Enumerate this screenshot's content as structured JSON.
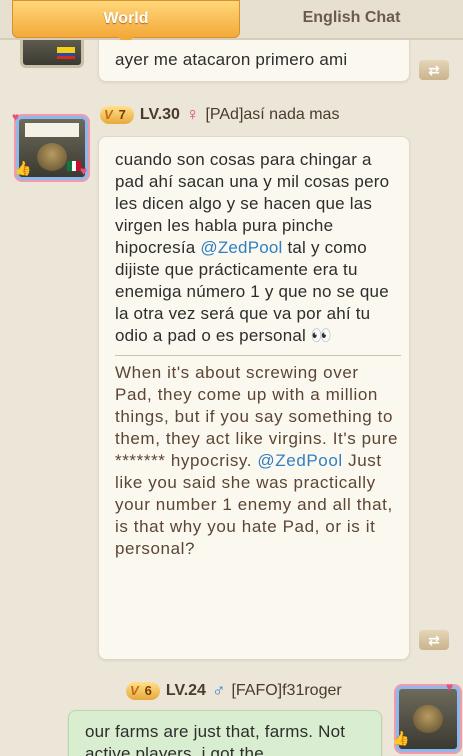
{
  "tabs": {
    "world": "World",
    "english": "English Chat"
  },
  "messages": [
    {
      "text": "ayer me atacaron primero ami"
    },
    {
      "vip": "7",
      "level": "LV.30",
      "gender": "female",
      "name": "[PAd]así nada mas",
      "original_parts": [
        "cuando son cosas para chingar a pad ahí sacan una y mil cosas pero les dicen algo y se hacen que las virgen les habla pura pinche hipocresía ",
        "@ZedPool",
        " tal y como dijiste que prácticamente era tu enemiga número 1 y que no se que la otra vez será que va por ahí tu odio a pad o es personal 👀"
      ],
      "translation_parts": [
        "When it's about screwing over Pad, they come up with a million things, but if you say something to them, they act like virgins. It's pure ******* hypocrisy. ",
        "@ZedPool",
        " Just like you said she was practically your number 1 enemy and all that, is that why you hate Pad, or is it personal?"
      ]
    },
    {
      "vip": "6",
      "level": "LV.24",
      "gender": "male",
      "name": "[FAFO]f31roger",
      "text": "our farms are just that, farms. Not active players, i got the"
    }
  ],
  "colors": {
    "accent": "#f3a93a",
    "mention": "#2f7fc3",
    "green_bubble": "#d9edd0"
  },
  "icons": [
    "translate-icon",
    "female-icon",
    "male-icon",
    "eyes-emoji",
    "thumbs-up-icon",
    "heart-icon"
  ]
}
